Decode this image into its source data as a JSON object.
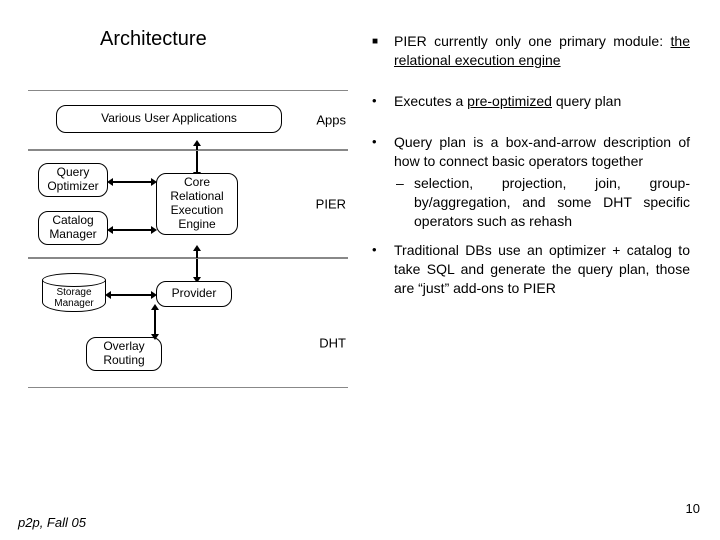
{
  "title": "Architecture",
  "diagram": {
    "layers": [
      "Apps",
      "PIER",
      "DHT"
    ],
    "apps_box": "Various User Applications",
    "pier": {
      "query_optimizer": "Query\nOptimizer",
      "catalog_manager": "Catalog\nManager",
      "core_engine": "Core\nRelational\nExecution\nEngine"
    },
    "dht": {
      "storage_manager": "Storage\nManager",
      "provider": "Provider",
      "overlay_routing": "Overlay\nRouting"
    }
  },
  "bullets": {
    "b1": "PIER currently only one primary module: ",
    "b1_underlined": "the relational execution engine",
    "b2_pre": "Executes a ",
    "b2_underlined": "pre-optimized",
    "b2_post": " query plan",
    "b3": "Query plan is a box-and-arrow description of how to connect basic operators together",
    "b3_sub": "selection, projection, join, group-by/aggregation, and some DHT specific operators such as rehash",
    "b4": "Traditional DBs use an optimizer + catalog to take SQL and generate the query plan, those are “just” add-ons to PIER"
  },
  "footer": "p2p, Fall 05",
  "page_number": "10"
}
